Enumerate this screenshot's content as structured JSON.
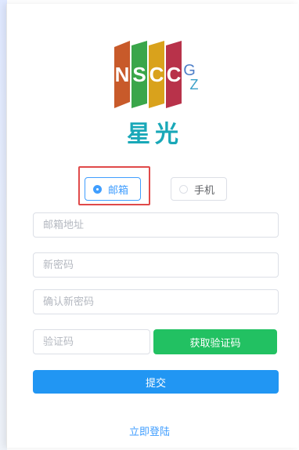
{
  "logo": {
    "letters": [
      "N",
      "S",
      "C",
      "C",
      "G",
      "Z"
    ]
  },
  "brand": {
    "name": "星光"
  },
  "login_type": {
    "options": [
      {
        "label": "邮箱",
        "selected": true
      },
      {
        "label": "手机",
        "selected": false
      }
    ]
  },
  "form": {
    "email_placeholder": "邮箱地址",
    "new_password_placeholder": "新密码",
    "confirm_password_placeholder": "确认新密码",
    "code_placeholder": "验证码",
    "get_code_label": "获取验证码",
    "submit_label": "提交"
  },
  "footer": {
    "login_link": "立即登陆"
  },
  "colors": {
    "primary": "#2196f3",
    "green": "#22c162",
    "highlight": "#e04a4a",
    "brand": "#19a8b8"
  }
}
